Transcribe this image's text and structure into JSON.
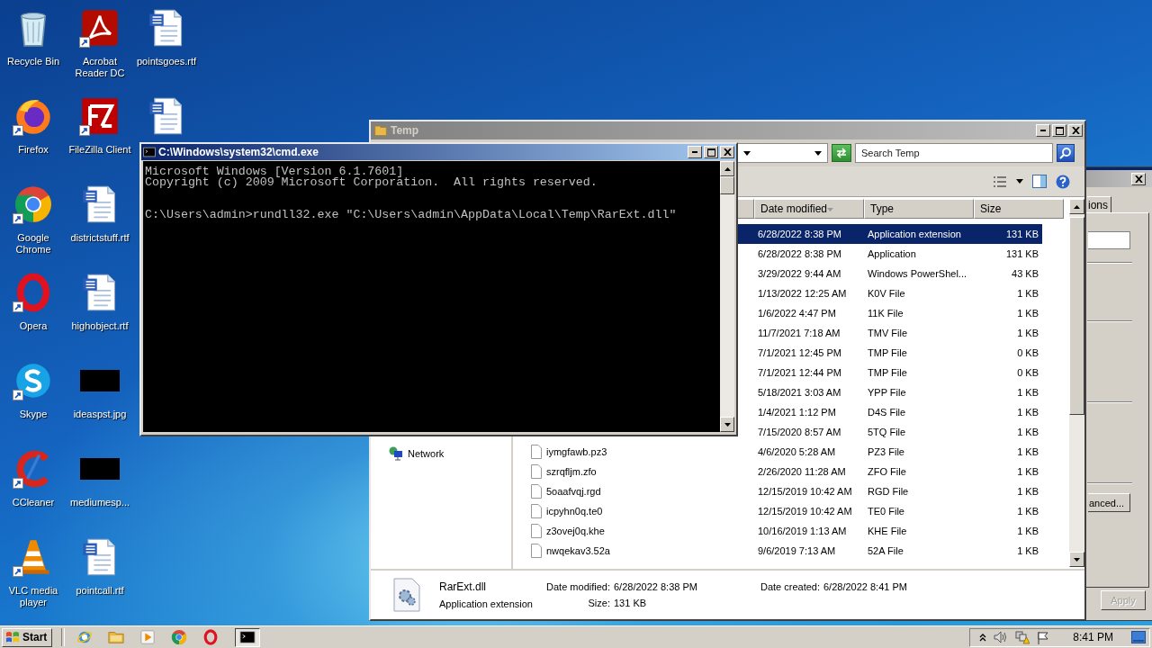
{
  "desktop_icons": [
    {
      "label": "Recycle Bin",
      "kind": "recycle-bin",
      "shortcut": false
    },
    {
      "label": "Firefox",
      "kind": "firefox",
      "shortcut": true
    },
    {
      "label": "Google Chrome",
      "kind": "chrome",
      "shortcut": true
    },
    {
      "label": "Opera",
      "kind": "opera",
      "shortcut": true
    },
    {
      "label": "Skype",
      "kind": "skype",
      "shortcut": true
    },
    {
      "label": "CCleaner",
      "kind": "ccleaner",
      "shortcut": true
    },
    {
      "label": "VLC media player",
      "kind": "vlc",
      "shortcut": true
    },
    {
      "label": "Acrobat Reader DC",
      "kind": "acrobat",
      "shortcut": true
    },
    {
      "label": "FileZilla Client",
      "kind": "filezilla",
      "shortcut": true
    },
    {
      "label": "districtstuff.rtf",
      "kind": "document",
      "shortcut": false
    },
    {
      "label": "highobject.rtf",
      "kind": "document",
      "shortcut": false
    },
    {
      "label": "ideaspst.jpg",
      "kind": "image",
      "shortcut": false
    },
    {
      "label": "mediumesp...",
      "kind": "image",
      "shortcut": false
    },
    {
      "label": "pointcall.rtf",
      "kind": "document",
      "shortcut": false
    },
    {
      "label": "pointsgoes.rtf",
      "kind": "document",
      "shortcut": false
    },
    {
      "kind": "document",
      "shortcut": false
    }
  ],
  "dialog": {
    "tab": "ions",
    "button": "anced...",
    "apply": {
      "label": "Apply",
      "disabled": true
    }
  },
  "explorer": {
    "title": "Temp",
    "search": {
      "placeholder": "Search Temp"
    },
    "columns": [
      {
        "label": "Date modified",
        "sorted": true
      },
      {
        "label": "Type",
        "sorted": false
      },
      {
        "label": "Size",
        "sorted": false
      }
    ],
    "nav": [
      {
        "label": "Network"
      }
    ],
    "rows": [
      {
        "date": "6/28/2022 8:38 PM",
        "type": "Application extension",
        "size": "131 KB",
        "selected": true
      },
      {
        "date": "6/28/2022 8:38 PM",
        "type": "Application",
        "size": "131 KB",
        "selected": false
      },
      {
        "date": "3/29/2022 9:44 AM",
        "type": "Windows PowerShel...",
        "size": "43 KB",
        "selected": false
      },
      {
        "date": "1/13/2022 12:25 AM",
        "type": "K0V File",
        "size": "1 KB",
        "selected": false
      },
      {
        "date": "1/6/2022 4:47 PM",
        "type": "11K File",
        "size": "1 KB",
        "selected": false
      },
      {
        "date": "11/7/2021 7:18 AM",
        "type": "TMV File",
        "size": "1 KB",
        "selected": false
      },
      {
        "date": "7/1/2021 12:45 PM",
        "type": "TMP File",
        "size": "0 KB",
        "selected": false
      },
      {
        "date": "7/1/2021 12:44 PM",
        "type": "TMP File",
        "size": "0 KB",
        "selected": false
      },
      {
        "date": "5/18/2021 3:03 AM",
        "type": "YPP File",
        "size": "1 KB",
        "selected": false
      },
      {
        "date": "1/4/2021 1:12 PM",
        "type": "D4S File",
        "size": "1 KB",
        "selected": false
      },
      {
        "date": "7/15/2020 8:57 AM",
        "type": "5TQ File",
        "size": "1 KB",
        "selected": false
      },
      {
        "name": "iymgfawb.pz3",
        "date": "4/6/2020 5:28 AM",
        "type": "PZ3 File",
        "size": "1 KB",
        "selected": false
      },
      {
        "name": "szrqfljm.zfo",
        "date": "2/26/2020 11:28 AM",
        "type": "ZFO File",
        "size": "1 KB",
        "selected": false
      },
      {
        "name": "5oaafvqj.rgd",
        "date": "12/15/2019 10:42 AM",
        "type": "RGD File",
        "size": "1 KB",
        "selected": false
      },
      {
        "name": "icpyhn0q.te0",
        "date": "12/15/2019 10:42 AM",
        "type": "TE0 File",
        "size": "1 KB",
        "selected": false
      },
      {
        "name": "z3ovej0q.khe",
        "date": "10/16/2019 1:13 AM",
        "type": "KHE File",
        "size": "1 KB",
        "selected": false
      },
      {
        "name": "nwqekav3.52a",
        "date": "9/6/2019 7:13 AM",
        "type": "52A File",
        "size": "1 KB",
        "selected": false
      }
    ],
    "details": {
      "name": "RarExt.dll",
      "type": "Application extension",
      "fields": [
        {
          "label": "Date modified:",
          "value": "6/28/2022 8:38 PM"
        },
        {
          "label": "Size:",
          "value": "131 KB"
        },
        {
          "label": "Date created:",
          "value": "6/28/2022 8:41 PM"
        }
      ]
    }
  },
  "cmd": {
    "title": "C:\\Windows\\system32\\cmd.exe",
    "output": [
      "Microsoft Windows [Version 6.1.7601]",
      "Copyright (c) 2009 Microsoft Corporation.  All rights reserved."
    ],
    "prompt": "C:\\Users\\admin>rundll32.exe \"C:\\Users\\admin\\AppData\\Local\\Temp\\RarExt.dll\""
  },
  "taskbar": {
    "start": "Start",
    "apps": [
      {
        "kind": "ie",
        "active": false
      },
      {
        "kind": "folder",
        "active": false
      },
      {
        "kind": "media",
        "active": false
      },
      {
        "kind": "chrome",
        "active": false
      },
      {
        "kind": "opera",
        "active": false
      },
      {
        "kind": "cmd",
        "active": true
      }
    ],
    "clock": "8:41 PM"
  }
}
